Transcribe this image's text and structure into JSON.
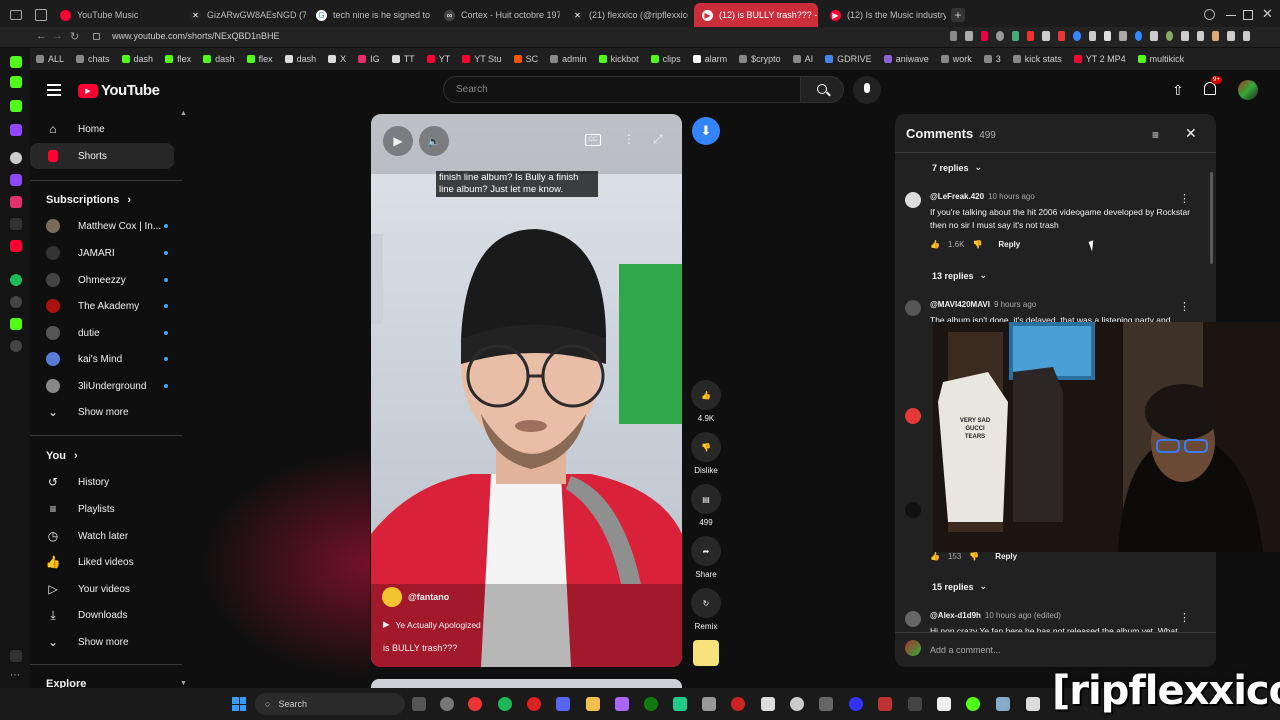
{
  "browser": {
    "tabs": [
      {
        "label": "YouTube Music",
        "color": "#ff0033"
      },
      {
        "label": "GizARwGW8AEsNGD (74)",
        "color": "#222222"
      },
      {
        "label": "tech nine is he signed to a",
        "color": "#ffffff"
      },
      {
        "label": "Cortex - Huit octobre 1971",
        "color": "#dddddd"
      },
      {
        "label": "(21) flexxico (@ripflexxico",
        "color": "#222222"
      },
      {
        "label": "(12) is BULLY trash??? - Y",
        "color": "#ff0033"
      },
      {
        "label": "(12) Is the Music industry",
        "color": "#ff0033"
      }
    ],
    "url": "www.youtube.com/shorts/NExQBD1nBHE",
    "bookmarks": [
      {
        "label": "ALL",
        "color": "#cfcfcf"
      },
      {
        "label": "chats",
        "color": "#cfcfcf"
      },
      {
        "label": "dash",
        "color": "#53fc18"
      },
      {
        "label": "flex",
        "color": "#53fc18"
      },
      {
        "label": "dash",
        "color": "#53fc18"
      },
      {
        "label": "flex",
        "color": "#53fc18"
      },
      {
        "label": "dash",
        "color": "#cfcfcf"
      },
      {
        "label": "X",
        "color": "#cfcfcf"
      },
      {
        "label": "IG",
        "color": "#e1306c"
      },
      {
        "label": "TT",
        "color": "#cfcfcf"
      },
      {
        "label": "YT",
        "color": "#ff0033"
      },
      {
        "label": "YT Stu",
        "color": "#ff0033"
      },
      {
        "label": "SC",
        "color": "#ff5500"
      },
      {
        "label": "admin",
        "color": "#cfcfcf"
      },
      {
        "label": "kickbot",
        "color": "#53fc18"
      },
      {
        "label": "clips",
        "color": "#53fc18"
      },
      {
        "label": "alarm",
        "color": "#cfcfcf"
      },
      {
        "label": "$crypto",
        "color": "#cfcfcf"
      },
      {
        "label": "AI",
        "color": "#cfcfcf"
      },
      {
        "label": "GDRIVE",
        "color": "#4285f4"
      },
      {
        "label": "aniwave",
        "color": "#8a63d2"
      },
      {
        "label": "work",
        "color": "#cfcfcf"
      },
      {
        "label": "3",
        "color": "#cfcfcf"
      },
      {
        "label": "kick stats",
        "color": "#cfcfcf"
      },
      {
        "label": "YT 2 MP4",
        "color": "#ff0033"
      },
      {
        "label": "multikick",
        "color": "#53fc18"
      }
    ]
  },
  "youtube": {
    "logo": "YouTube",
    "search_placeholder": "Search",
    "notification_count": "9+",
    "sidebar": {
      "home": "Home",
      "shorts": "Shorts",
      "subscriptions_heading": "Subscriptions",
      "subscriptions": [
        {
          "label": "Matthew Cox | In...",
          "color": "#7a6a5a"
        },
        {
          "label": "JAMARI",
          "color": "#333333"
        },
        {
          "label": "Ohmeezzy",
          "color": "#444444"
        },
        {
          "label": "The Akademy",
          "color": "#aa1111"
        },
        {
          "label": "dutie",
          "color": "#555555"
        },
        {
          "label": "kai's Mind",
          "color": "#5a7bd6"
        },
        {
          "label": "3liUnderground",
          "color": "#888888"
        }
      ],
      "show_more_1": "Show more",
      "you_heading": "You",
      "you_items": [
        {
          "label": "History",
          "icon": "history-icon"
        },
        {
          "label": "Playlists",
          "icon": "playlists-icon"
        },
        {
          "label": "Watch later",
          "icon": "watch-later-icon"
        },
        {
          "label": "Liked videos",
          "icon": "liked-icon"
        },
        {
          "label": "Your videos",
          "icon": "your-videos-icon"
        },
        {
          "label": "Downloads",
          "icon": "downloads-icon"
        }
      ],
      "show_more_2": "Show more",
      "explore_heading": "Explore"
    },
    "short": {
      "caption": "finish line album? Is Bully a finish line album? Just let me know.",
      "channel": "@fantano",
      "music": "Ye Actually Apologized",
      "title": "is BULLY trash???",
      "likes": "4.9K",
      "dislike_label": "Dislike",
      "comments_count": "499",
      "share_label": "Share",
      "remix_label": "Remix"
    },
    "comments": {
      "title": "Comments",
      "count": "499",
      "items": [
        {
          "replies": "7 replies"
        },
        {
          "author": "@LeFreak.420",
          "time": "10 hours ago",
          "text": "If you're talking about the hit 2006 videogame developed by Rockstar then no sir I must say it's not trash",
          "likes": "1.6K",
          "reply_label": "Reply",
          "replies": "13 replies"
        },
        {
          "author": "@MAVI420MAVI",
          "time": "9 hours ago",
          "text": "The album isn't done, it's delayed, that was a listening party and"
        },
        {
          "likes": "153",
          "reply_label": "Reply",
          "replies": "15 replies"
        },
        {
          "author": "@Alex-d1d9h",
          "time": "10 hours ago (edited)",
          "text": "Hi non crazy Ye fan here he has not released the album yet. What"
        }
      ],
      "add_placeholder": "Add a comment..."
    }
  },
  "taskbar": {
    "search_label": "Search"
  },
  "overlay": {
    "watermark": "[ripflexxico]",
    "shirt_text_1": "VERY SAD",
    "shirt_text_2": "GUCCI TEARS"
  }
}
